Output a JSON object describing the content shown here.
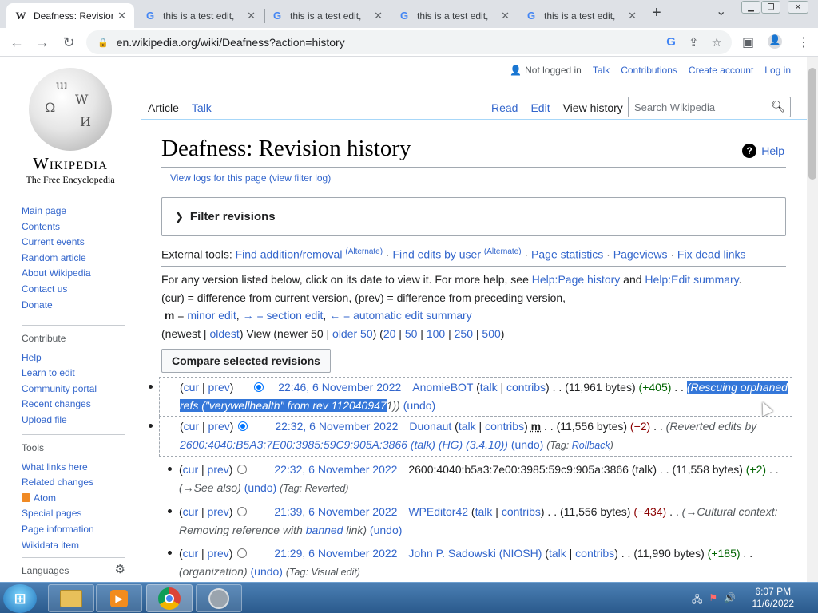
{
  "browser": {
    "tabs": [
      {
        "title": "Deafness: Revision history",
        "favicon": "W",
        "active": true
      },
      {
        "title": "this is a test edit, ",
        "favicon": "G",
        "active": false
      },
      {
        "title": "this is a test edit, ",
        "favicon": "G",
        "active": false
      },
      {
        "title": "this is a test edit, ",
        "favicon": "G",
        "active": false
      },
      {
        "title": "this is a test edit, ",
        "favicon": "G",
        "active": false
      }
    ],
    "new_tab": "+",
    "tab_menu": "⌄",
    "url": "en.wikipedia.org/wiki/Deafness?action=history"
  },
  "sidebar": {
    "wordmark": "Wikipedia",
    "tagline": "The Free Encyclopedia",
    "nav": [
      "Main page",
      "Contents",
      "Current events",
      "Random article",
      "About Wikipedia",
      "Contact us",
      "Donate"
    ],
    "contribute_heading": "Contribute",
    "contribute": [
      "Help",
      "Learn to edit",
      "Community portal",
      "Recent changes",
      "Upload file"
    ],
    "tools_heading": "Tools",
    "tools": [
      "What links here",
      "Related changes",
      "Atom",
      "Special pages",
      "Page information",
      "Wikidata item"
    ],
    "languages_heading": "Languages"
  },
  "user": {
    "not_logged_in": "Not logged in",
    "talk": "Talk",
    "contributions": "Contributions",
    "create_account": "Create account",
    "log_in": "Log in"
  },
  "tabs": {
    "article": "Article",
    "talk": "Talk",
    "read": "Read",
    "edit": "Edit",
    "view_history": "View history"
  },
  "search_placeholder": "Search Wikipedia",
  "page": {
    "title": "Deafness: Revision history",
    "help": "Help",
    "logs": "View logs for this page",
    "filter_log": "(view filter log)",
    "filter_revisions": "Filter revisions",
    "external_tools_label": "External tools:",
    "ext_find": "Find addition/removal",
    "ext_alt": "(Alternate)",
    "ext_edits_by_user": "Find edits by user",
    "ext_alt2": "(Alternate)",
    "ext_stats": "Page statistics",
    "ext_pageviews": "Pageviews",
    "ext_dead": "Fix dead links",
    "info_line1_pre": "For any version listed below, click on its date to view it. For more help, see",
    "info_help_page_history": "Help:Page history",
    "info_and": "and",
    "info_help_edit_summary": "Help:Edit summary",
    "info_line2": "(cur) = difference from current version, (prev) = difference from preceding version,",
    "info_m": "m",
    "info_minor": "minor edit",
    "info_arrow_section": "→ = section edit",
    "info_arrow_auto": "← = automatic edit summary",
    "pager_newest": "newest",
    "pager_oldest": "oldest",
    "pager_view": "View (newer 50 |",
    "pager_older": "older 50",
    "pager_20": "20",
    "pager_50": "50",
    "pager_100": "100",
    "pager_250": "250",
    "pager_500": "500",
    "compare_button": "Compare selected revisions"
  },
  "revisions": [
    {
      "date": "22:46, 6 November 2022",
      "user": "AnomieBOT",
      "size": "(11,961 bytes)",
      "diff": "(+405)",
      "summary_a": "(Rescuing orphaned",
      "summary_b": "refs (\"verywellhealth\" from rev 112040947",
      "summary_c": "1))",
      "undo": "(undo)"
    },
    {
      "date": "22:32, 6 November 2022",
      "user": "Duonaut",
      "size": "(11,556 bytes)",
      "diff": "(−2)",
      "minor": "m",
      "summary_a": "(Reverted edits by",
      "summary_ip": "2600:4040:B5A3:7E00:3985:59C9:905A:3866",
      "summary_talk": "(talk)",
      "summary_hg": "(HG)",
      "summary_ver": "(3.4.10))",
      "undo": "(undo)",
      "tag": "(Tag: Rollback)"
    },
    {
      "date": "22:32, 6 November 2022",
      "user": "2600:4040:b5a3:7e00:3985:59c9:905a:3866",
      "size": "(11,558 bytes)",
      "diff": "(+2)",
      "summary_a": "(→See also)",
      "undo": "(undo)",
      "tag": "(Tag: Reverted)"
    },
    {
      "date": "21:39, 6 November 2022",
      "user": "WPEditor42",
      "size": "(11,556 bytes)",
      "diff": "(−434)",
      "summary_a": "(→Cultural context:",
      "summary_b": "Removing reference with",
      "summary_link": "banned",
      "summary_c": "link)",
      "undo": "(undo)"
    },
    {
      "date": "21:29, 6 November 2022",
      "user": "John P. Sadowski (NIOSH)",
      "size": "(11,990 bytes)",
      "diff": "(+185)",
      "summary_a": "(organization)",
      "undo": "(undo)",
      "tag": "(Tag: Visual edit)"
    }
  ],
  "rev_labels": {
    "cur": "cur",
    "prev": "prev",
    "talk": "talk",
    "contribs": "contribs"
  },
  "taskbar": {
    "time": "6:07 PM",
    "date": "11/6/2022"
  },
  "colors": {
    "link": "#3366cc",
    "highlight": "#3477d9",
    "positive": "#006400",
    "negative": "#8b0000"
  }
}
